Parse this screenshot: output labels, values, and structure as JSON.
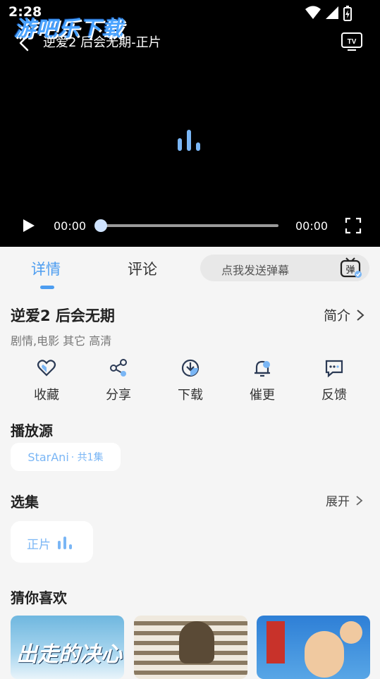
{
  "status": {
    "time": "2:28"
  },
  "watermark": "游吧乐下载",
  "player": {
    "title": "逆爱2 后会无期-正片",
    "current_time": "00:00",
    "total_time": "00:00",
    "progress": 0
  },
  "tabs": [
    {
      "label": "详情",
      "active": true
    },
    {
      "label": "评论",
      "active": false
    }
  ],
  "danmaku": {
    "placeholder": "点我发送弹幕",
    "icon_text": "弹"
  },
  "show": {
    "title": "逆爱2 后会无期",
    "intro_label": "简介",
    "meta": "剧情,电影 其它 高清"
  },
  "actions": [
    {
      "label": "收藏",
      "icon": "heart-icon"
    },
    {
      "label": "分享",
      "icon": "share-icon"
    },
    {
      "label": "下载",
      "icon": "download-icon"
    },
    {
      "label": "催更",
      "icon": "bell-icon"
    },
    {
      "label": "反馈",
      "icon": "feedback-icon"
    }
  ],
  "source": {
    "section_title": "播放源",
    "name": "StarAni",
    "count": " · 共1集"
  },
  "episodes": {
    "section_title": "选集",
    "expand_label": "展开",
    "items": [
      {
        "label": "正片",
        "playing": true
      }
    ]
  },
  "recommend": {
    "section_title": "猜你喜欢",
    "cards": [
      {
        "title": "出走的决心"
      },
      {
        "title": ""
      },
      {
        "title": ""
      }
    ]
  },
  "colors": {
    "accent": "#4d9df0",
    "chip_text": "#7ab6f5",
    "background": "#f5f5f5",
    "player": "#000000"
  }
}
